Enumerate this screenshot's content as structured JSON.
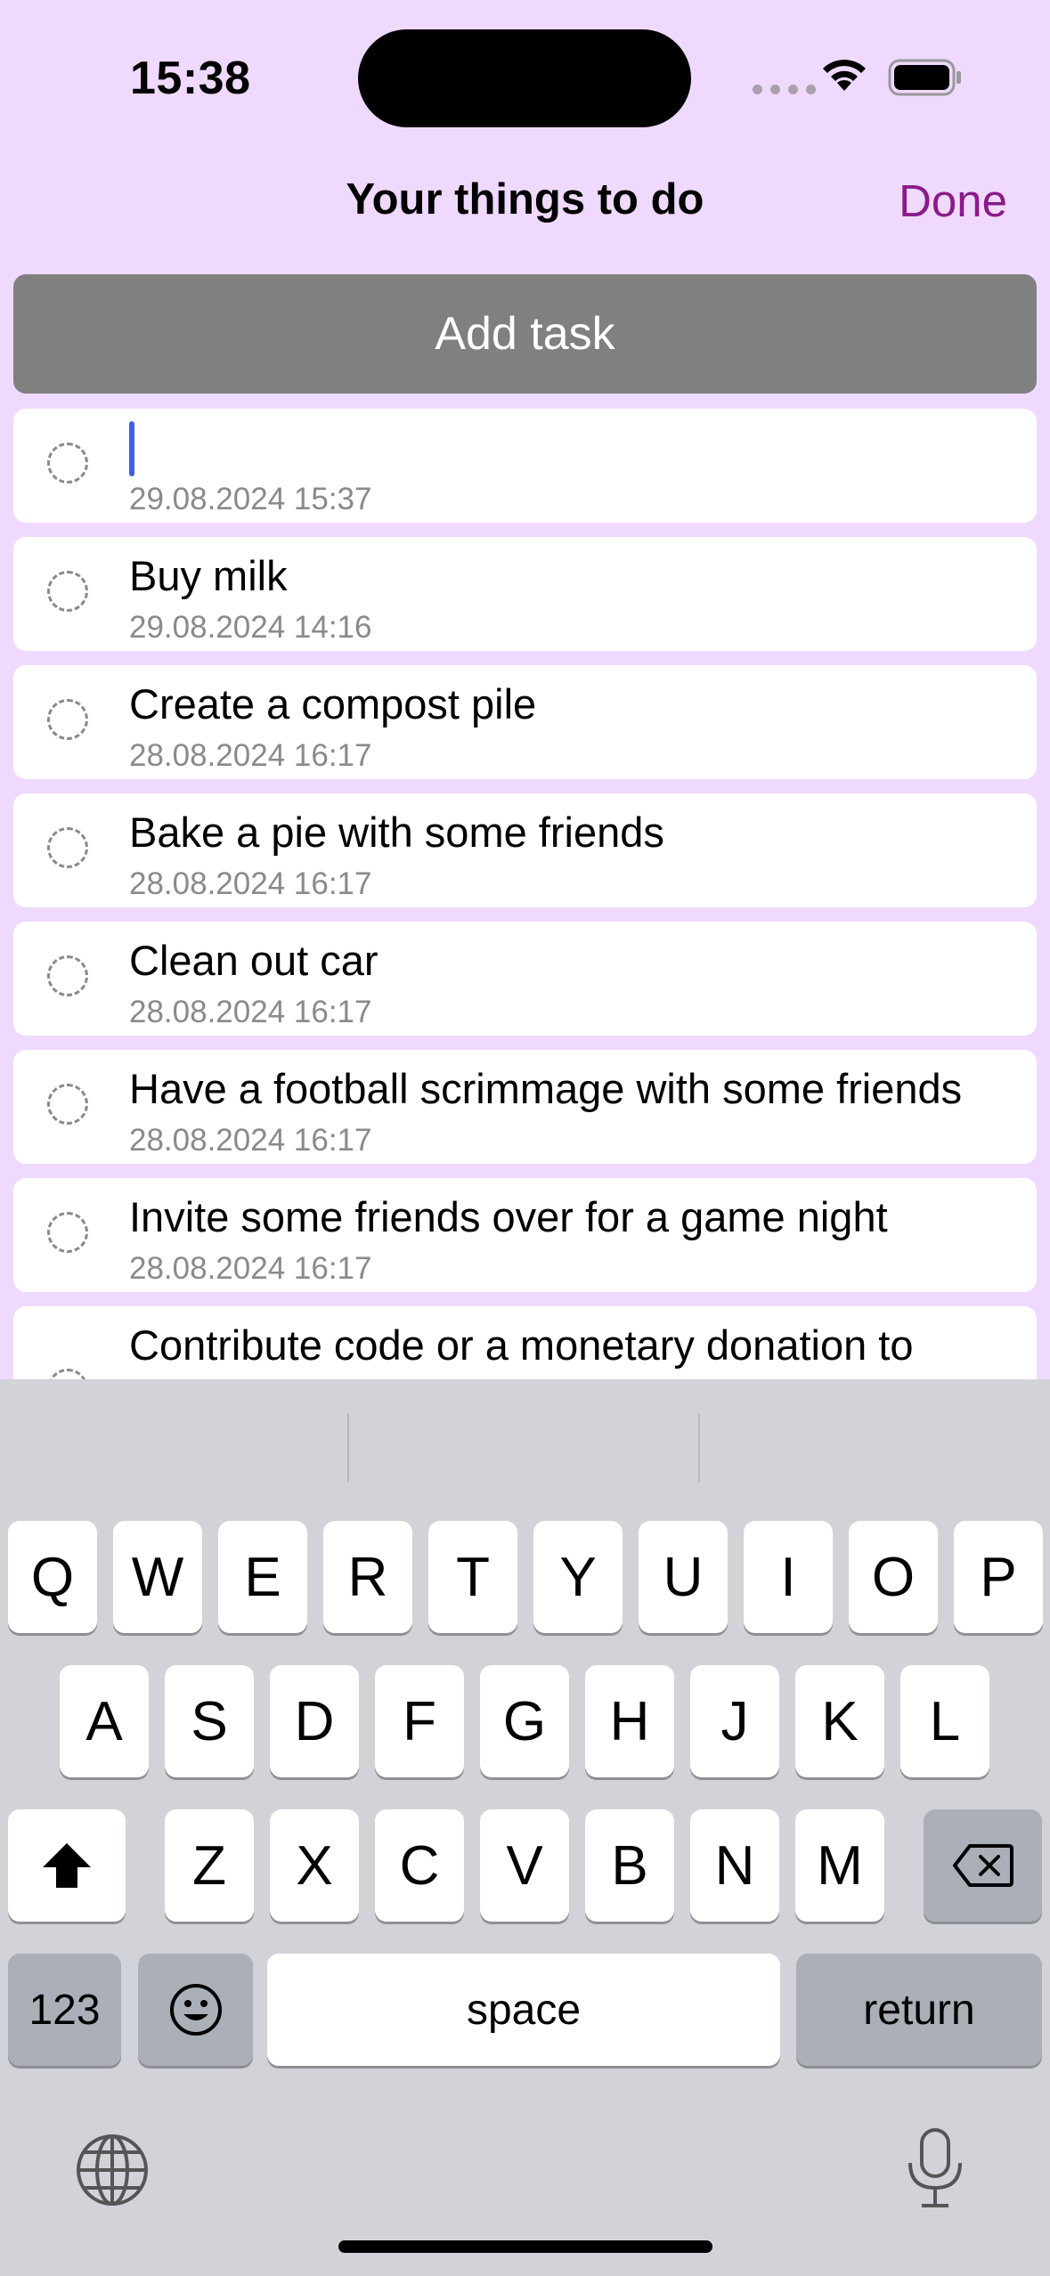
{
  "status_bar": {
    "time": "15:38"
  },
  "nav": {
    "title": "Your things to do",
    "done_label": "Done"
  },
  "add_task_label": "Add task",
  "tasks": [
    {
      "title": "",
      "date": "29.08.2024 15:37",
      "editing": true
    },
    {
      "title": "Buy milk",
      "date": "29.08.2024 14:16"
    },
    {
      "title": "Create a compost pile",
      "date": "28.08.2024 16:17"
    },
    {
      "title": "Bake a pie with some friends",
      "date": "28.08.2024 16:17"
    },
    {
      "title": "Clean out car",
      "date": "28.08.2024 16:17"
    },
    {
      "title": "Have a football scrimmage with some friends",
      "date": "28.08.2024 16:17"
    },
    {
      "title": "Invite some friends over for a game night",
      "date": "28.08.2024 16:17"
    },
    {
      "title": "Contribute code or a monetary donation to",
      "date": ""
    }
  ],
  "keyboard": {
    "row1": [
      "Q",
      "W",
      "E",
      "R",
      "T",
      "Y",
      "U",
      "I",
      "O",
      "P"
    ],
    "row2": [
      "A",
      "S",
      "D",
      "F",
      "G",
      "H",
      "J",
      "K",
      "L"
    ],
    "row3": [
      "Z",
      "X",
      "C",
      "V",
      "B",
      "N",
      "M"
    ],
    "numbers_label": "123",
    "space_label": "space",
    "return_label": "return"
  },
  "colors": {
    "background": "#f0d9ff",
    "accent": "#8a1a8a",
    "button": "#808080",
    "cursor": "#3f60e6"
  }
}
